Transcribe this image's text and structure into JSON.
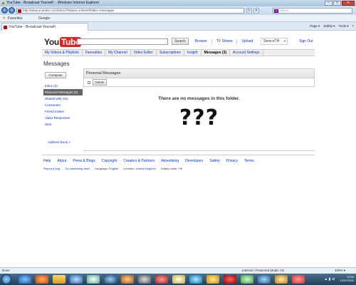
{
  "browser": {
    "window_title": "YouTube - Broadcast Yourself. - Windows Internet Explorer",
    "address": "http://www.youtube.com/inbox?feature=mhee#/folder=messages",
    "search_placeholder": "Yahoo",
    "favorites_label": "Favorites",
    "favorites_item": "Google",
    "tab_title": "YouTube - Broadcast Yourself.",
    "commands": [
      "Page ▾",
      "Safety ▾",
      "Tools ▾",
      "?"
    ],
    "window_buttons": [
      "–",
      "□",
      "✕"
    ]
  },
  "youtube": {
    "logo_you": "You",
    "logo_tube": "Tube",
    "search_button": "Search",
    "top_links": [
      "Browse",
      "TV Shows",
      "Upload"
    ],
    "username": "SemcoTH",
    "sign_out": "Sign Out",
    "tabs": [
      {
        "label": "My Videos & Playlists",
        "active": false
      },
      {
        "label": "Favourites",
        "active": false
      },
      {
        "label": "My Channel",
        "active": false
      },
      {
        "label": "Video Editor",
        "active": false
      },
      {
        "label": "Subscriptions",
        "active": false
      },
      {
        "label": "Insight",
        "active": false
      },
      {
        "label": "Messages (3)",
        "active": true
      },
      {
        "label": "Account Settings",
        "active": false
      }
    ],
    "page_title": "Messages",
    "compose": "Compose",
    "folders": [
      {
        "label": "Inbox (3)",
        "selected": false
      },
      {
        "label": "Personal Messages (3)",
        "selected": true
      },
      {
        "label": "Shared with You",
        "selected": false
      },
      {
        "label": "Comments",
        "selected": false
      },
      {
        "label": "Friend Invites",
        "selected": false
      },
      {
        "label": "Video Responses",
        "selected": false
      },
      {
        "label": "Sent",
        "selected": false
      }
    ],
    "address_book": "Address Book »",
    "panel_title": "Personal Messages",
    "delete_button": "Delete",
    "empty_message": "There are no messages in this folder.",
    "overlay_text": "???",
    "footer_links": [
      "Help",
      "About",
      "Press & Blogs",
      "Copyright",
      "Creators & Partners",
      "Advertising",
      "Developers",
      "Safety",
      "Privacy",
      "Terms"
    ],
    "footer_sub": {
      "report_bug": "Report a bug",
      "try_new": "Try something new!",
      "language_label": "Language:",
      "language_value": "English",
      "location_label": "Location:",
      "location_value": "United Kingdom",
      "safety_label": "Safety mode:",
      "safety_value": "Off"
    }
  },
  "status": {
    "done": "Done",
    "zone": "Internet | Protected Mode: On",
    "zoom": "100% ▾"
  },
  "taskbar": {
    "time": "14:59",
    "date": "12/07/2011"
  },
  "colors": {
    "link": "#0033cc",
    "youtube_red": "#dd2222",
    "selected_folder": "#666666"
  }
}
